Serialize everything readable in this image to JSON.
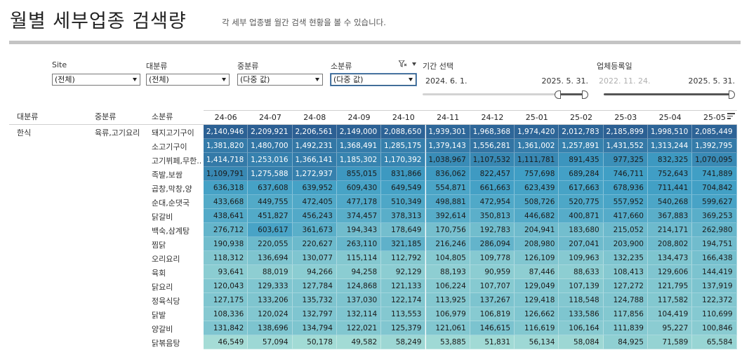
{
  "header": {
    "title": "월별 세부업종 검색량",
    "subtitle": "각 세부 업종별 월간 검색 현황을 볼 수 있습니다."
  },
  "filters": {
    "site": {
      "label": "Site",
      "value": "(전체)"
    },
    "major": {
      "label": "대분류",
      "value": "(전체)"
    },
    "middle": {
      "label": "중분류",
      "value": "(다중 값)"
    },
    "minor": {
      "label": "소분류",
      "value": "(다중 값)"
    }
  },
  "period": {
    "label": "기간 선택",
    "start": "2024. 6. 1.",
    "end": "2025. 5. 31."
  },
  "registration": {
    "label": "업체등록일",
    "start": "2022. 11. 24.",
    "end": "2025. 5. 31."
  },
  "table": {
    "dim_headers": [
      "대분류",
      "중분류",
      "소분류"
    ],
    "major": "한식",
    "middle": "육류,고기요리",
    "months": [
      "24-06",
      "24-07",
      "24-08",
      "24-09",
      "24-10",
      "24-11",
      "24-12",
      "25-01",
      "25-02",
      "25-03",
      "25-04",
      "25-05"
    ],
    "rows": [
      {
        "name": "돼지고기구이",
        "values": [
          "2,140,946",
          "2,209,921",
          "2,206,561",
          "2,149,000",
          "2,088,650",
          "1,939,301",
          "1,968,368",
          "1,974,420",
          "2,012,783",
          "2,185,899",
          "1,998,510",
          "2,085,449"
        ]
      },
      {
        "name": "소고기구이",
        "values": [
          "1,381,820",
          "1,480,700",
          "1,492,231",
          "1,368,491",
          "1,285,175",
          "1,379,143",
          "1,556,281",
          "1,361,002",
          "1,257,891",
          "1,431,552",
          "1,313,244",
          "1,392,795"
        ]
      },
      {
        "name": "고기뷔페,무한..",
        "values": [
          "1,414,718",
          "1,253,016",
          "1,366,141",
          "1,185,302",
          "1,170,392",
          "1,038,967",
          "1,107,532",
          "1,111,781",
          "891,435",
          "977,325",
          "832,325",
          "1,070,095"
        ]
      },
      {
        "name": "족발,보쌈",
        "values": [
          "1,109,791",
          "1,275,588",
          "1,272,937",
          "855,015",
          "831,866",
          "836,062",
          "822,457",
          "757,698",
          "689,284",
          "746,711",
          "752,643",
          "741,889"
        ]
      },
      {
        "name": "곱창,막창,양",
        "values": [
          "636,318",
          "637,608",
          "639,952",
          "609,430",
          "649,549",
          "554,871",
          "661,663",
          "623,439",
          "617,663",
          "678,936",
          "711,441",
          "704,842"
        ]
      },
      {
        "name": "순대,순댓국",
        "values": [
          "433,668",
          "449,755",
          "472,405",
          "477,178",
          "510,349",
          "498,881",
          "472,954",
          "508,726",
          "520,775",
          "557,952",
          "540,268",
          "599,627"
        ]
      },
      {
        "name": "닭갈비",
        "values": [
          "438,641",
          "451,827",
          "456,243",
          "374,457",
          "378,313",
          "392,614",
          "350,813",
          "446,682",
          "400,871",
          "417,660",
          "367,883",
          "369,253"
        ]
      },
      {
        "name": "백숙,삼계탕",
        "values": [
          "276,712",
          "603,617",
          "361,673",
          "194,343",
          "178,649",
          "170,756",
          "192,783",
          "204,941",
          "183,680",
          "215,052",
          "214,171",
          "262,980"
        ]
      },
      {
        "name": "찜닭",
        "values": [
          "190,938",
          "220,055",
          "220,627",
          "263,110",
          "321,185",
          "216,246",
          "286,094",
          "208,980",
          "207,041",
          "203,900",
          "208,802",
          "194,751"
        ]
      },
      {
        "name": "오리요리",
        "values": [
          "118,312",
          "136,694",
          "130,077",
          "115,114",
          "112,792",
          "104,805",
          "109,778",
          "126,109",
          "109,963",
          "132,235",
          "134,473",
          "166,438"
        ]
      },
      {
        "name": "육회",
        "values": [
          "93,641",
          "88,019",
          "94,266",
          "94,258",
          "92,129",
          "88,193",
          "90,959",
          "87,446",
          "88,633",
          "108,413",
          "129,606",
          "144,419"
        ]
      },
      {
        "name": "닭요리",
        "values": [
          "120,043",
          "129,333",
          "127,784",
          "124,868",
          "121,133",
          "106,224",
          "107,707",
          "129,049",
          "107,139",
          "127,272",
          "121,795",
          "137,919"
        ]
      },
      {
        "name": "정육식당",
        "values": [
          "127,175",
          "133,206",
          "135,732",
          "137,030",
          "122,174",
          "113,925",
          "137,267",
          "129,418",
          "118,548",
          "124,788",
          "117,582",
          "122,372"
        ]
      },
      {
        "name": "닭발",
        "values": [
          "108,336",
          "120,024",
          "132,797",
          "132,114",
          "113,553",
          "106,979",
          "106,819",
          "126,662",
          "133,586",
          "117,856",
          "104,419",
          "110,699"
        ]
      },
      {
        "name": "양갈비",
        "values": [
          "131,842",
          "138,696",
          "134,794",
          "122,021",
          "125,379",
          "121,061",
          "146,615",
          "116,619",
          "106,164",
          "111,839",
          "95,227",
          "100,846"
        ]
      },
      {
        "name": "닭볶음탕",
        "values": [
          "46,549",
          "57,094",
          "50,178",
          "49,582",
          "58,249",
          "53,885",
          "51,831",
          "56,134",
          "58,084",
          "84,925",
          "71,589",
          "65,584"
        ]
      }
    ]
  },
  "colors": {
    "scale_high": "#2b5d91",
    "scale_mid": "#3f9ec5",
    "scale_low": "#a6ddd6",
    "accent_border": "#1f4e79"
  }
}
